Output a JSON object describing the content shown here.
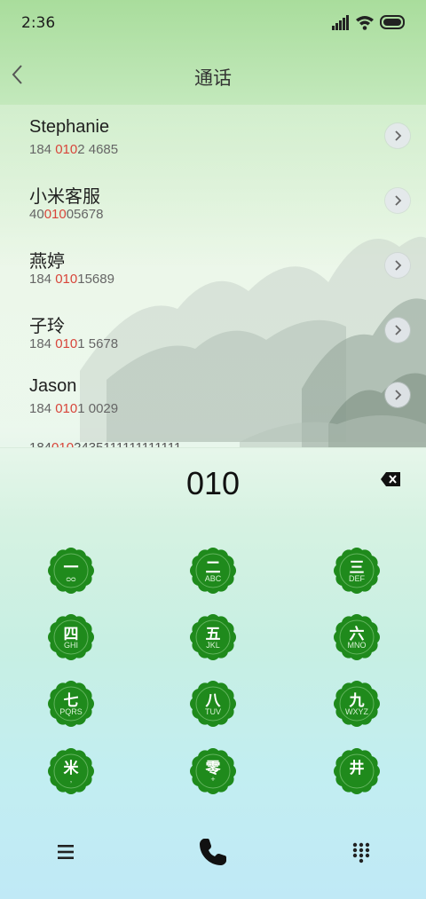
{
  "status": {
    "time": "2:36"
  },
  "header": {
    "title": "通话"
  },
  "contacts": [
    {
      "name": "Stephanie",
      "number_pre": "184 ",
      "number_hl": "010",
      "number_post": "2 4685"
    },
    {
      "name": "小米客服",
      "number_pre": "40",
      "number_hl": "010",
      "number_post": "05678"
    },
    {
      "name": "燕婷",
      "number_pre": "184 ",
      "number_hl": "010",
      "number_post": "15689"
    },
    {
      "name": "子玲",
      "number_pre": "184 ",
      "number_hl": "010",
      "number_post": "1 5678"
    },
    {
      "name": "Jason",
      "number_pre": "184 ",
      "number_hl": "010",
      "number_post": "1 0029"
    }
  ],
  "partial_row": {
    "pre": "184",
    "hl": "010",
    "post": "2435111111111111"
  },
  "dialer": {
    "number": "010"
  },
  "keys": [
    {
      "char": "一",
      "sub": "ᴑᴑ"
    },
    {
      "char": "二",
      "sub": "ABC"
    },
    {
      "char": "三",
      "sub": "DEF"
    },
    {
      "char": "四",
      "sub": "GHI"
    },
    {
      "char": "五",
      "sub": "JKL"
    },
    {
      "char": "六",
      "sub": "MNO"
    },
    {
      "char": "七",
      "sub": "PQRS"
    },
    {
      "char": "八",
      "sub": "TUV"
    },
    {
      "char": "九",
      "sub": "WXYZ"
    },
    {
      "char": "米",
      "sub": ","
    },
    {
      "char": "零",
      "sub": "+"
    },
    {
      "char": "井",
      "sub": ""
    }
  ],
  "colors": {
    "key_green": "#1f8a1c",
    "highlight": "#d8453a"
  },
  "icons": {
    "back": "chevron-left-icon",
    "detail": "chevron-right-icon",
    "backspace": "backspace-icon",
    "menu": "menu-icon",
    "call": "phone-icon",
    "dialpad": "dialpad-icon"
  }
}
